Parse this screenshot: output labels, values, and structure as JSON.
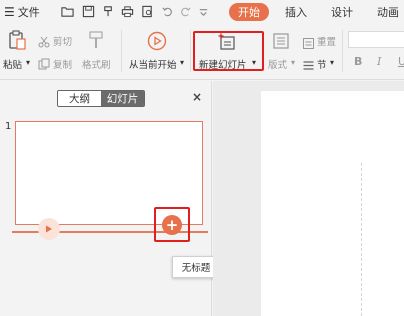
{
  "menubar": {
    "file_label": "文件",
    "tabs": {
      "start": "开始",
      "insert": "插入",
      "design": "设计",
      "animation": "动画"
    },
    "quick_access": [
      "open-folder-icon",
      "save-icon",
      "format-painter-icon",
      "print-icon",
      "print-preview-icon",
      "undo-icon",
      "redo-icon",
      "customize-icon"
    ]
  },
  "ribbon": {
    "paste": "粘贴",
    "cut": "剪切",
    "copy": "复制",
    "format_painter": "格式刷",
    "play_from_current": "从当前开始",
    "new_slide": "新建幻灯片",
    "layout": "版式",
    "reset": "重置",
    "section": "节"
  },
  "left_panel": {
    "tab_outline": "大纲",
    "tab_slides": "幻灯片",
    "close": "×",
    "slide_number": "1",
    "add_button": "+",
    "tooltip": "无标题"
  },
  "colors": {
    "accent": "#e8704a",
    "highlight_box": "#e0201f"
  }
}
